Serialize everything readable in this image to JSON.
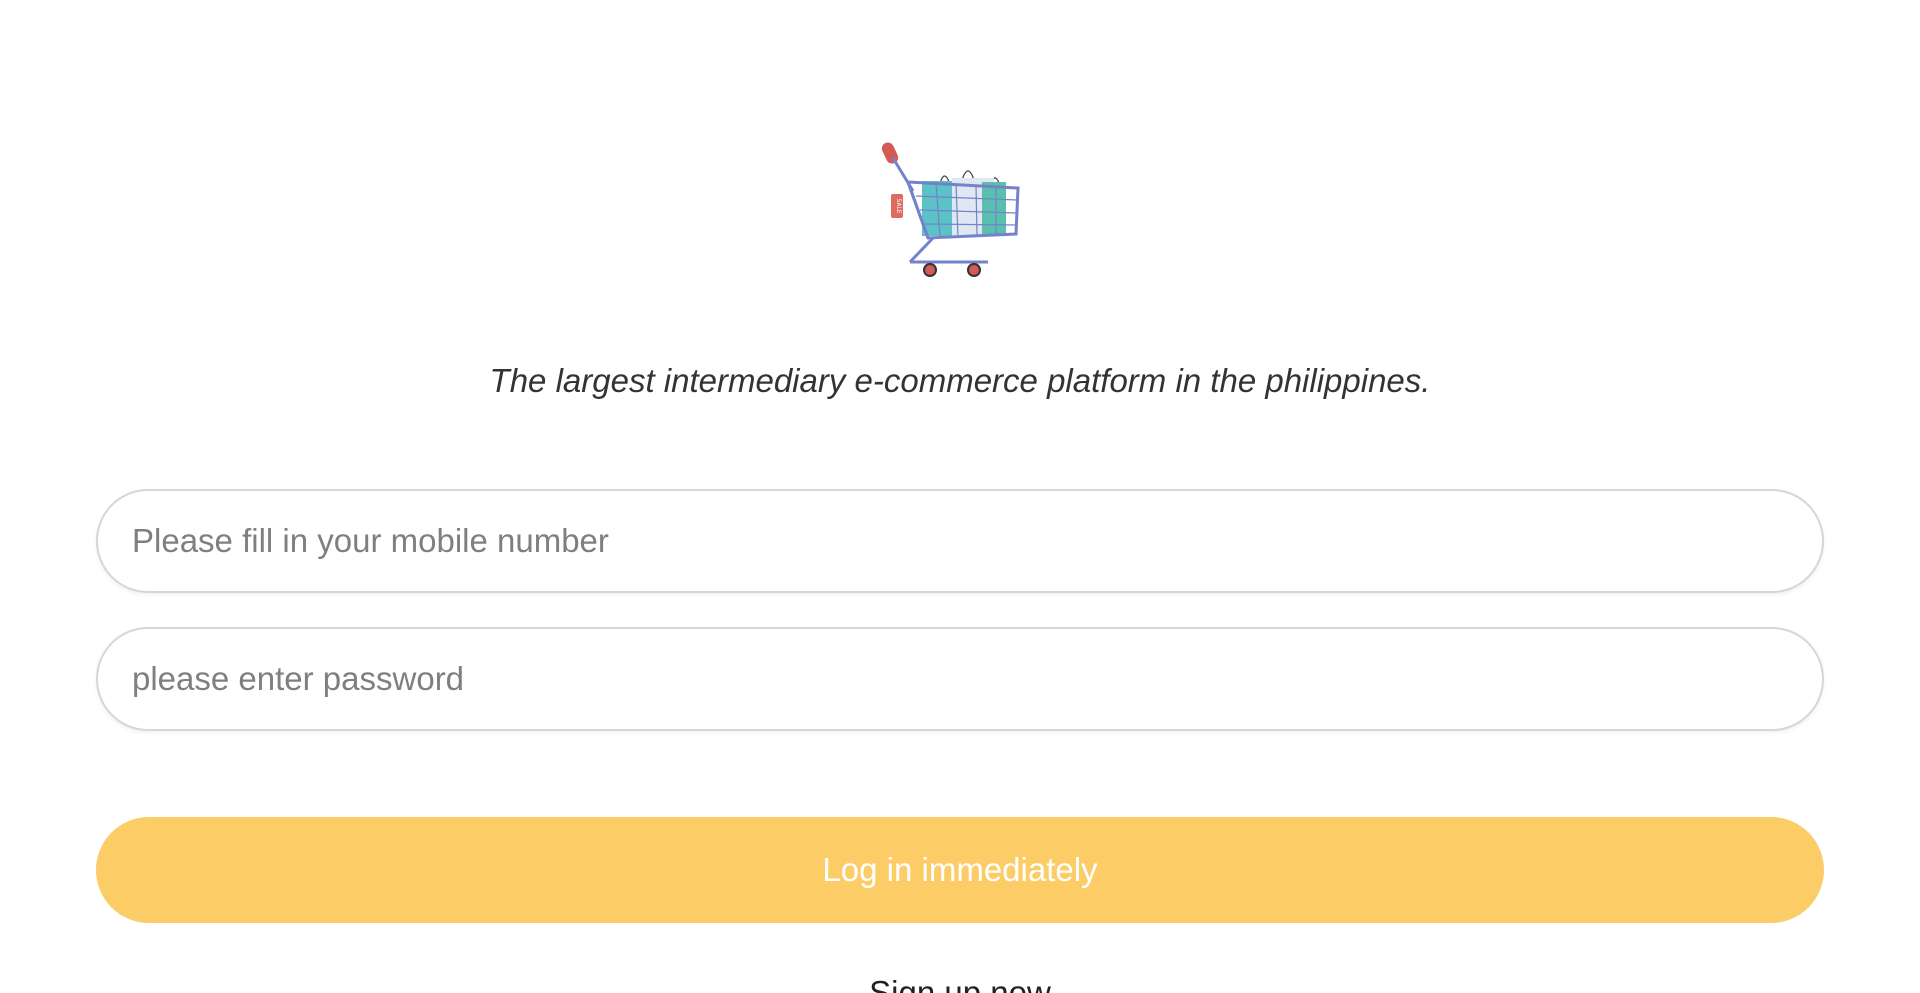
{
  "logo": {
    "icon": "shopping-cart-icon",
    "tag_text": "SALE"
  },
  "tagline": "The largest intermediary e-commerce platform in the philippines.",
  "form": {
    "phone_placeholder": "Please fill in your mobile number",
    "password_placeholder": "please enter password",
    "login_label": "Log in immediately",
    "signup_label": "Sign up now"
  },
  "colors": {
    "accent": "#fccc66",
    "field_border": "#d3d6dc",
    "cart_frame": "#7482cc",
    "bag_teal": "#5bc2c8",
    "sale_tag": "#d9534f"
  }
}
